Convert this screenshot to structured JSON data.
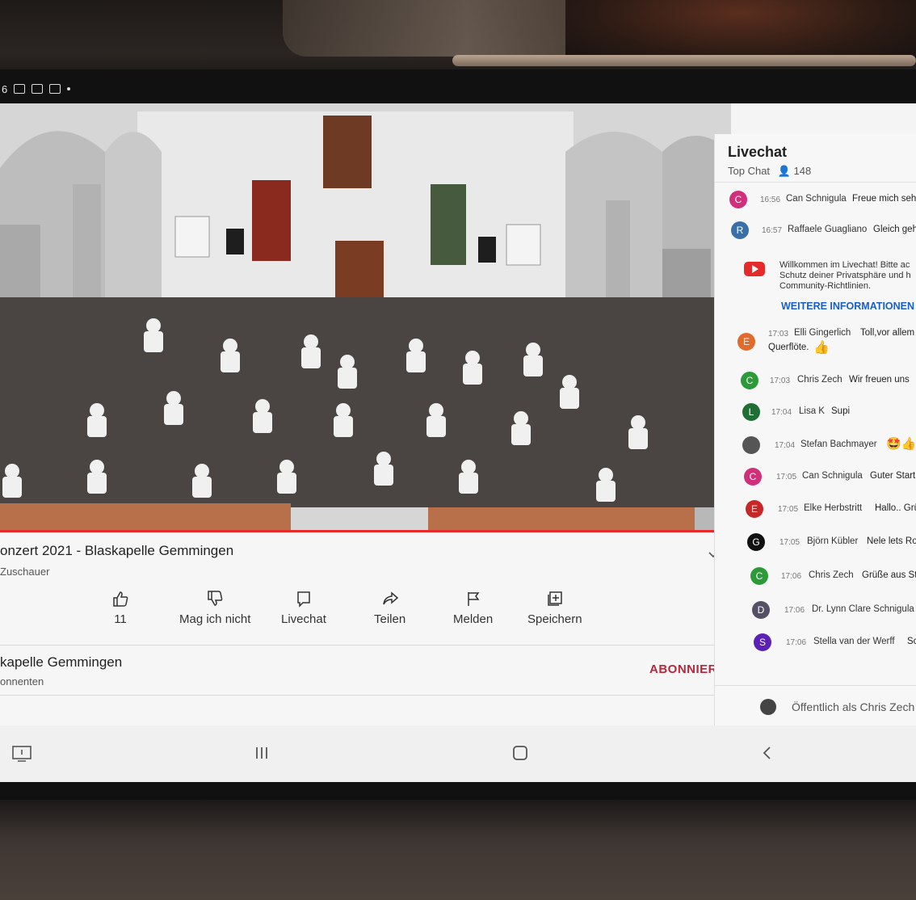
{
  "video": {
    "title": "onzert 2021 - Blaskapelle Gemmingen",
    "viewers_label": "Zuschauer"
  },
  "actions": {
    "like_count": "11",
    "dislike_label": "Mag ich nicht",
    "livechat_label": "Livechat",
    "share_label": "Teilen",
    "report_label": "Melden",
    "save_label": "Speichern"
  },
  "channel": {
    "name": "kapelle Gemmingen",
    "subscribers_label": "onnenten",
    "subscribe_label": "ABONNIEREN"
  },
  "chat": {
    "title": "Livechat",
    "mode": "Top Chat",
    "viewer_count": "148",
    "messages": [
      {
        "initial": "C",
        "color": "#d12f7a",
        "time": "16:56",
        "author": "Can Schnigula",
        "text": "Freue mich sehr"
      },
      {
        "initial": "R",
        "color": "#3a6fa8",
        "time": "16:57",
        "author": "Raffaele Guagliano",
        "text": "Gleich geh"
      },
      {
        "initial": "E",
        "color": "#e26a2c",
        "time": "17:03",
        "author": "Elli Gingerlich",
        "text": "Toll,vor allem",
        "text2": "Querflöte."
      },
      {
        "initial": "C",
        "color": "#2d9a3a",
        "time": "17:03",
        "author": "Chris Zech",
        "text": "Wir freuen uns"
      },
      {
        "initial": "L",
        "color": "#1f6e34",
        "time": "17:04",
        "author": "Lisa K",
        "text": "Supi"
      },
      {
        "initial": "",
        "color": "#555555",
        "time": "17:04",
        "author": "Stefan Bachmayer",
        "text": "🤩👍"
      },
      {
        "initial": "C",
        "color": "#d12f7a",
        "time": "17:05",
        "author": "Can Schnigula",
        "text": "Guter Start"
      },
      {
        "initial": "E",
        "color": "#c62828",
        "time": "17:05",
        "author": "Elke Herbstritt",
        "text": "Hallo.. Grü"
      },
      {
        "initial": "G",
        "color": "#111111",
        "time": "17:05",
        "author": "Björn Kübler",
        "text": "Nele lets Ro"
      },
      {
        "initial": "C",
        "color": "#2d9a3a",
        "time": "17:06",
        "author": "Chris Zech",
        "text": "Grüße aus St"
      },
      {
        "initial": "D",
        "color": "#555066",
        "time": "17:06",
        "author": "Dr. Lynn Clare Schnigula",
        "text": ""
      },
      {
        "initial": "S",
        "color": "#5b21b6",
        "time": "17:06",
        "author": "Stella van der Werff",
        "text": "Sc"
      }
    ],
    "notice": {
      "text": "Willkommen im Livechat! Bitte ac Schutz deiner Privatsphäre und h Community-Richtlinien.",
      "link": "WEITERE INFORMATIONEN"
    },
    "input_placeholder": "Öffentlich als Chris Zech"
  },
  "status_bar": {
    "time_fragment": "6"
  }
}
